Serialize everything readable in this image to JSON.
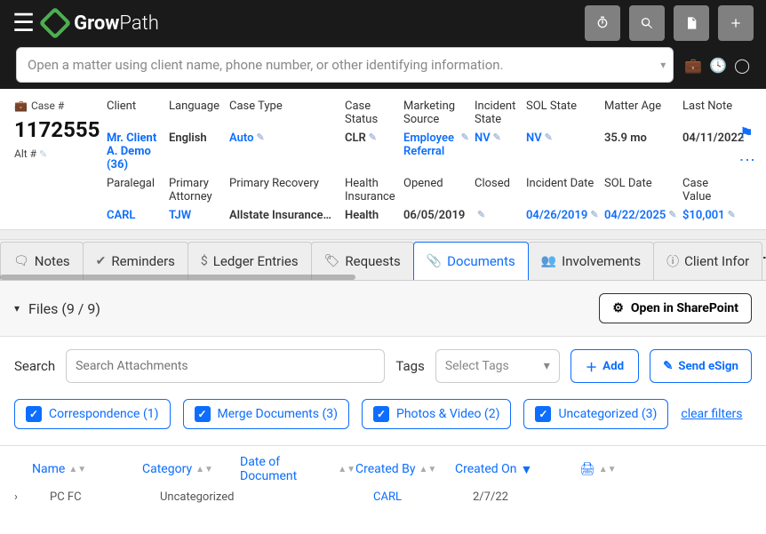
{
  "app": {
    "name_strong": "Grow",
    "name_light": "Path"
  },
  "search": {
    "placeholder": "Open a matter using client name, phone number, or other identifying information."
  },
  "case": {
    "label": "Case #",
    "number": "1172555",
    "alt_label": "Alt #",
    "row1": {
      "client_hdr": "Client",
      "client_val": "Mr. Client A. Demo (36)",
      "language_hdr": "Language",
      "language_val": "English",
      "casetype_hdr": "Case Type",
      "casetype_val": "Auto",
      "casestatus_hdr": "Case Status",
      "casestatus_val": "CLR",
      "marketing_hdr": "Marketing Source",
      "marketing_val": "Employee Referral",
      "incstate_hdr": "Incident State",
      "incstate_val": "NV",
      "solstate_hdr": "SOL State",
      "solstate_val": "NV",
      "matterage_hdr": "Matter Age",
      "matterage_val": "35.9 mo",
      "lastnote_hdr": "Last Note",
      "lastnote_val": "04/11/2022"
    },
    "row2": {
      "paralegal_hdr": "Paralegal",
      "paralegal_val": "CARL",
      "attorney_hdr": "Primary Attorney",
      "attorney_val": "TJW",
      "recovery_hdr": "Primary Recovery",
      "recovery_val": "Allstate Insurance…",
      "health_hdr": "Health Insurance",
      "health_val": "Health",
      "opened_hdr": "Opened",
      "opened_val": "06/05/2019",
      "closed_hdr": "Closed",
      "closed_val": "",
      "incdate_hdr": "Incident Date",
      "incdate_val": "04/26/2019",
      "soldate_hdr": "SOL Date",
      "soldate_val": "04/22/2025",
      "casevalue_hdr": "Case Value",
      "casevalue_val": "$10,001"
    }
  },
  "tabs": {
    "notes": "Notes",
    "reminders": "Reminders",
    "ledger": "Ledger Entries",
    "requests": "Requests",
    "documents": "Documents",
    "involvements": "Involvements",
    "clientinfo": "Client Infor"
  },
  "files": {
    "header": "Files (9 / 9)",
    "sharepoint": "Open in SharePoint",
    "search_label": "Search",
    "search_placeholder": "Search Attachments",
    "tags_label": "Tags",
    "tags_placeholder": "Select Tags",
    "add": "Add",
    "esign": "Send eSign",
    "chips": {
      "correspondence": "Correspondence (1)",
      "merge": "Merge Documents (3)",
      "photos": "Photos & Video (2)",
      "uncat": "Uncategorized (3)"
    },
    "clear": "clear filters",
    "cols": {
      "name": "Name",
      "category": "Category",
      "date": "Date of Document",
      "by": "Created By",
      "on": "Created On"
    },
    "row0": {
      "name": "PC FC",
      "category": "Uncategorized",
      "by": "CARL",
      "on": "2/7/22"
    }
  }
}
